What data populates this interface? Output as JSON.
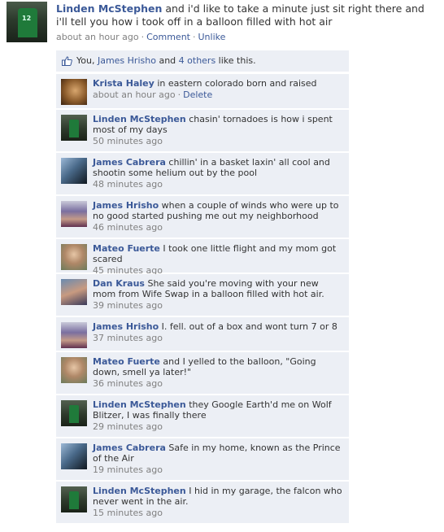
{
  "post": {
    "author": "Linden McStephen",
    "text": "and i'd like to take a minute just sit right there and i'll tell you how i took off in a balloon filled with hot air",
    "time": "about an hour ago",
    "comment_label": "Comment",
    "unlike_label": "Unlike"
  },
  "likes": {
    "you": "You",
    "sep1": ", ",
    "person": "James Hrisho",
    "and": " and ",
    "others": "4 others",
    "suffix": " like this."
  },
  "comments": [
    {
      "name": "Krista Haley",
      "text": "in eastern colorado born and raised",
      "time": "about an hour ago",
      "delete_label": "Delete"
    },
    {
      "name": "Linden McStephen",
      "text": "chasin' tornadoes is how i spent most of my days",
      "time": "50 minutes ago"
    },
    {
      "name": "James Cabrera",
      "text": "chillin' in a basket laxin' all cool and shootin some helium out by the pool",
      "time": "48 minutes ago"
    },
    {
      "name": "James Hrisho",
      "text": "when a couple of winds who were up to no good started pushing me out my neighborhood",
      "time": "46 minutes ago"
    },
    {
      "name": "Mateo Fuerte",
      "text": "I took one little flight and my mom got scared",
      "time": "45 minutes ago"
    },
    {
      "name": "Dan Kraus",
      "text": "She said you're moving with your new mom from Wife Swap in a balloon filled with hot air.",
      "time": "39 minutes ago"
    },
    {
      "name": "James Hrisho",
      "text": "I. fell. out of a box and wont turn 7 or 8",
      "time": "37 minutes ago"
    },
    {
      "name": "Mateo Fuerte",
      "text": "and I yelled to the balloon, \"Going down, smell ya later!\"",
      "time": "36 minutes ago"
    },
    {
      "name": "Linden McStephen",
      "text": "they Google Earth'd me on Wolf Blitzer, I was finally there",
      "time": "29 minutes ago"
    },
    {
      "name": "James Cabrera",
      "text": "Safe in my home, known as the Prince of the Air",
      "time": "19 minutes ago"
    },
    {
      "name": "Linden McStephen",
      "text": "I hid in my garage, the falcon who never went in the air.",
      "time": "15 minutes ago"
    }
  ]
}
